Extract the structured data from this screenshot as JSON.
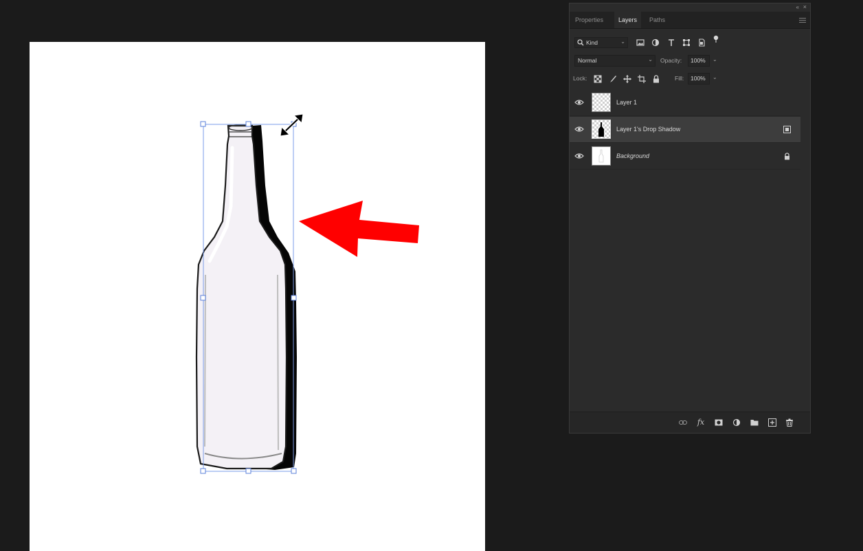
{
  "panel": {
    "tabs": [
      {
        "label": "Properties"
      },
      {
        "label": "Layers"
      },
      {
        "label": "Paths"
      }
    ],
    "filter": {
      "kind_label": "Kind"
    },
    "blend_mode": "Normal",
    "opacity_label": "Opacity:",
    "opacity_value": "100%",
    "lock_label": "Lock:",
    "fill_label": "Fill:",
    "fill_value": "100%",
    "layers": [
      {
        "name": "Layer 1"
      },
      {
        "name": "Layer 1's Drop Shadow"
      },
      {
        "name": "Background"
      }
    ],
    "bottom_icons": [
      "link-icon",
      "fx-icon",
      "mask-icon",
      "adjustment-icon",
      "folder-icon",
      "new-layer-icon",
      "trash-icon"
    ]
  },
  "colors": {
    "annotation_arrow": "#ff0000",
    "panel_bg": "#2b2b2b",
    "selected_layer": "#3d3d3d",
    "app_bg": "#1b1b1b"
  }
}
